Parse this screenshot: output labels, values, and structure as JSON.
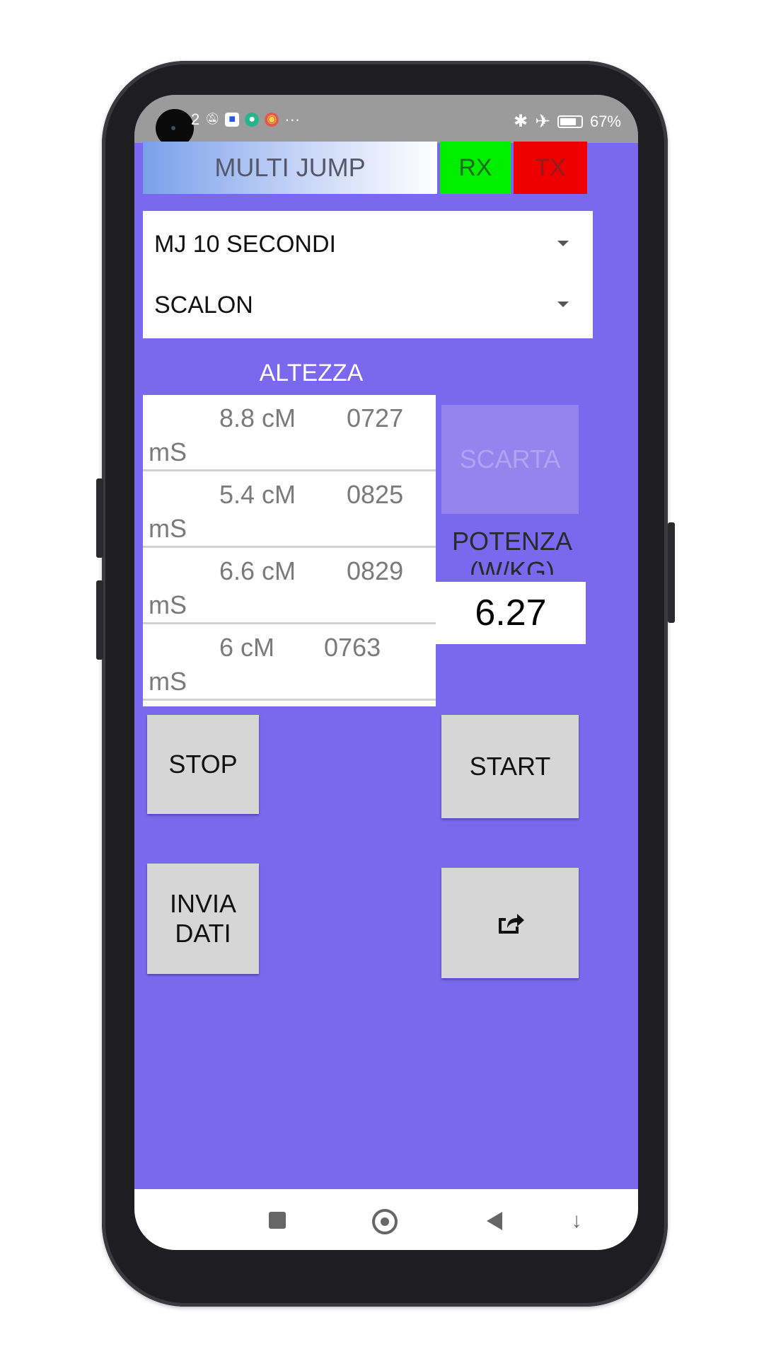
{
  "status_bar": {
    "left_text": "2",
    "more": "···",
    "battery_percent": "67%",
    "icons": [
      "camera-cutout",
      "notification-off-icon",
      "chat-icon",
      "location-app-icon",
      "chrome-icon",
      "bluetooth-icon",
      "airplane-icon",
      "battery-icon"
    ]
  },
  "app": {
    "title": "MULTI JUMP",
    "rx_label": "RX",
    "tx_label": "TX",
    "colors": {
      "background": "#7b68ee",
      "rx": "#00ee00",
      "tx": "#ee0000",
      "button": "#d6d6d6"
    }
  },
  "spinners": {
    "test_type": "MJ 10 SECONDI",
    "athlete": "SCALON"
  },
  "results": {
    "label": "ALTEZZA",
    "items": [
      {
        "height": "8.8 cM",
        "time": "0727",
        "unit": "mS"
      },
      {
        "height": "5.4 cM",
        "time": "0825",
        "unit": "mS"
      },
      {
        "height": "6.6 cM",
        "time": "0829",
        "unit": "mS"
      },
      {
        "height": "6 cM",
        "time": "0763",
        "unit": "mS"
      }
    ]
  },
  "scarta_label": "SCARTA",
  "potenza": {
    "label": "POTENZA (W/KG)",
    "value": "6.27"
  },
  "buttons": {
    "stop": "STOP",
    "start": "START",
    "send_line1": "INVIA",
    "send_line2": "DATI",
    "share_icon": "share-icon"
  },
  "nav_bar": {
    "icons": [
      "recents-icon",
      "home-icon",
      "back-icon",
      "assist-icon"
    ]
  }
}
